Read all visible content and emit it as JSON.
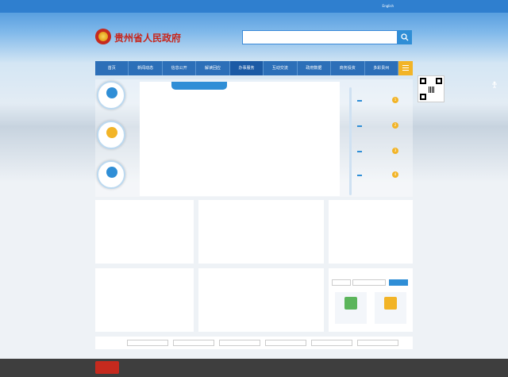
{
  "topbar": {
    "left_links": [],
    "right_links": [
      "English"
    ]
  },
  "header": {
    "logo_text": "贵州省人民政府",
    "search_placeholder": "",
    "hot_label": "",
    "hot_words": []
  },
  "nav": {
    "items": [
      "首页",
      "新闻动态",
      "信息公开",
      "解读回应",
      "办事服务",
      "互动交流",
      "政府数据",
      "商务投资",
      "多彩贵州"
    ]
  },
  "quick": {
    "items": []
  },
  "dept": {
    "title": "",
    "items": []
  },
  "steps": {
    "items": []
  },
  "service_left": {
    "tabs": [],
    "tiles": []
  },
  "service_mid": {
    "tabs": [],
    "icons": []
  },
  "service_right": {
    "tabs": [],
    "items": []
  },
  "convenience": {
    "title": "",
    "items": []
  },
  "public_notice": {
    "title": "",
    "headers": [],
    "rows": []
  },
  "query": {
    "title": "",
    "placeholder": "",
    "button": "",
    "cards": []
  },
  "links_bar": {
    "label": "",
    "selects": []
  },
  "footer": {
    "lines": []
  },
  "colors": {
    "primary": "#2f8ed6",
    "nav": "#2c6fb8",
    "accent": "#f2b427",
    "logo": "#c8251b"
  }
}
